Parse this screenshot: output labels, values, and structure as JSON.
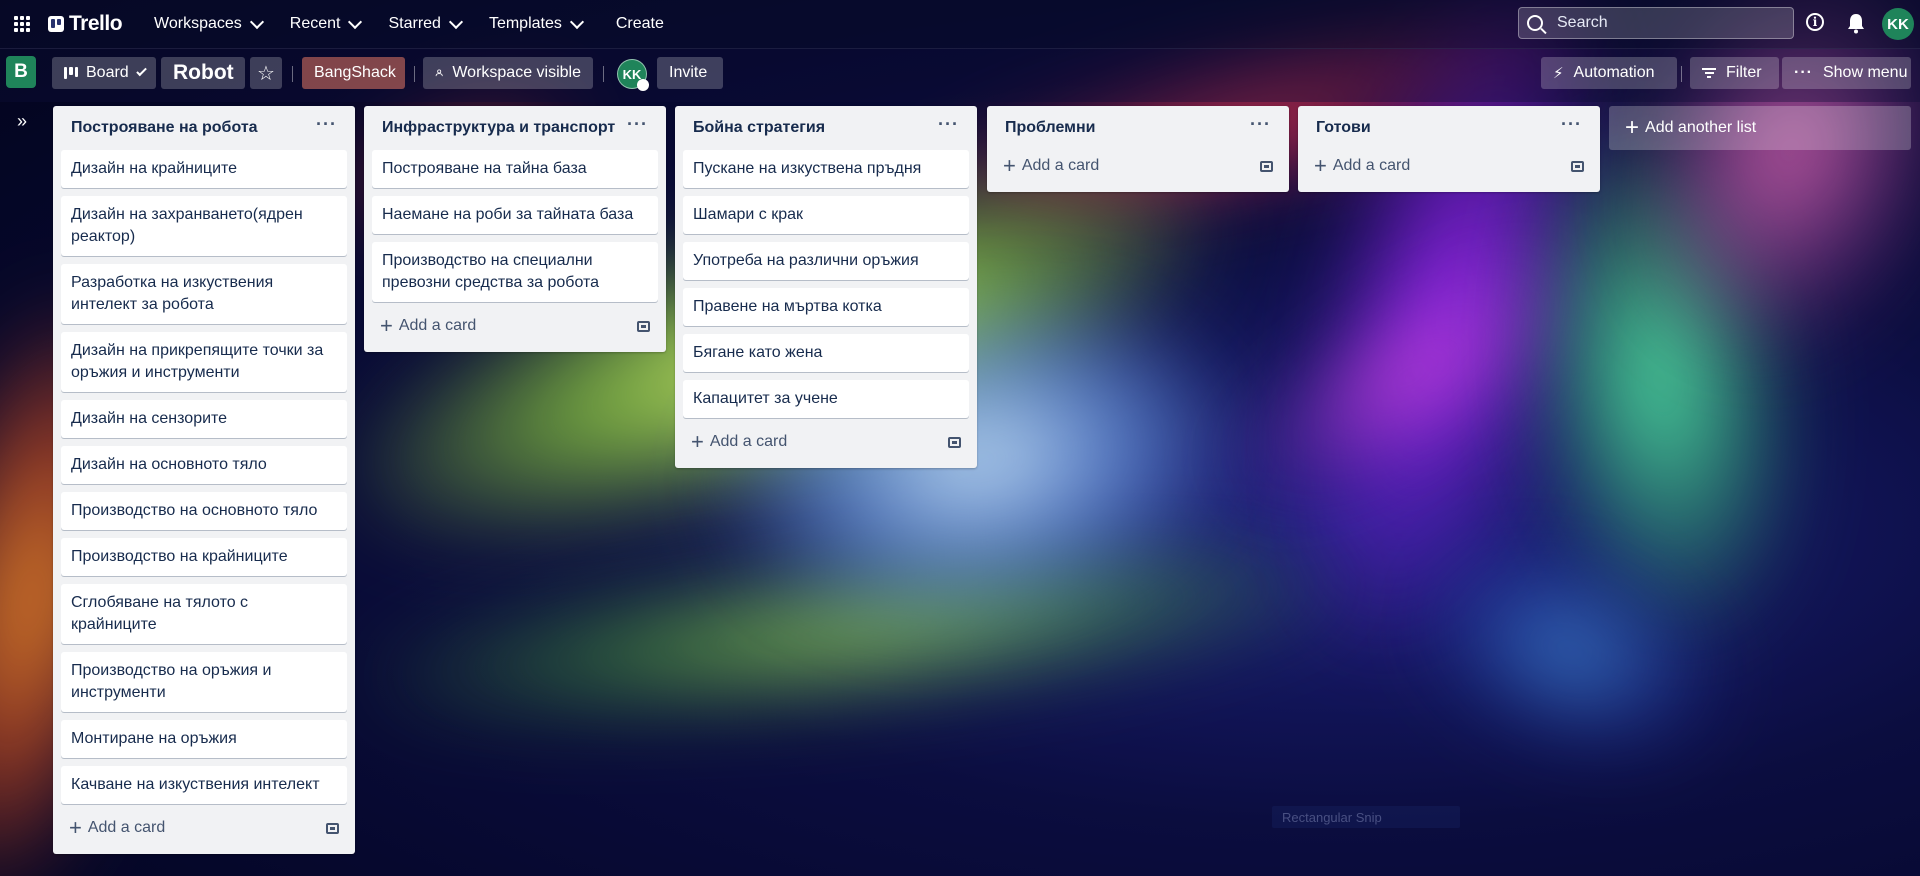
{
  "topbar": {
    "logo": "Trello",
    "nav": [
      "Workspaces",
      "Recent",
      "Starred",
      "Templates"
    ],
    "create": "Create",
    "search_placeholder": "Search",
    "avatar": "KK"
  },
  "board": {
    "workspace_initial": "B",
    "view": "Board",
    "title": "Robot",
    "workspace_name": "BangShack",
    "visibility": "Workspace visible",
    "member": "KK",
    "invite": "Invite",
    "automation": "Automation",
    "filter": "Filter",
    "show_menu": "Show menu"
  },
  "lists": [
    {
      "title": "Построяване на робота",
      "cards": [
        "Дизайн на крайниците",
        "Дизайн на захранването(ядрен реактор)",
        "Разработка на изкуствения интелект за робота",
        "Дизайн на прикрепящите точки за оръжия и инструменти",
        "Дизайн на сензорите",
        "Дизайн на основното тяло",
        "Производство на основното тяло",
        "Производство на крайниците",
        "Сглобяване на тялото с крайниците",
        "Производство на оръжия и инструменти",
        "Монтиране на оръжия",
        "Качване на изкуствения интелект"
      ],
      "add_card": "Add a card"
    },
    {
      "title": "Инфраструктура и транспорт",
      "cards": [
        "Построяване на тайна база",
        "Наемане на роби за тайната база",
        "Производство на специални превозни средства за робота"
      ],
      "add_card": "Add a card"
    },
    {
      "title": "Бойна стратегия",
      "cards": [
        "Пускане на изкуствена пръдня",
        "Шамари с крак",
        "Употреба на различни оръжия",
        "Правене на мъртва котка",
        "Бягане като жена",
        "Капацитет за учене"
      ],
      "add_card": "Add a card"
    },
    {
      "title": "Проблемни",
      "cards": [],
      "add_card": "Add a card"
    },
    {
      "title": "Готови",
      "cards": [],
      "add_card": "Add a card"
    }
  ],
  "add_list": "Add another list",
  "overlay_text": "Rectangular Snip",
  "colors": {
    "avatar_green": "#1f845a",
    "list_bg": "#f1f2f4",
    "text": "#172b4d"
  }
}
